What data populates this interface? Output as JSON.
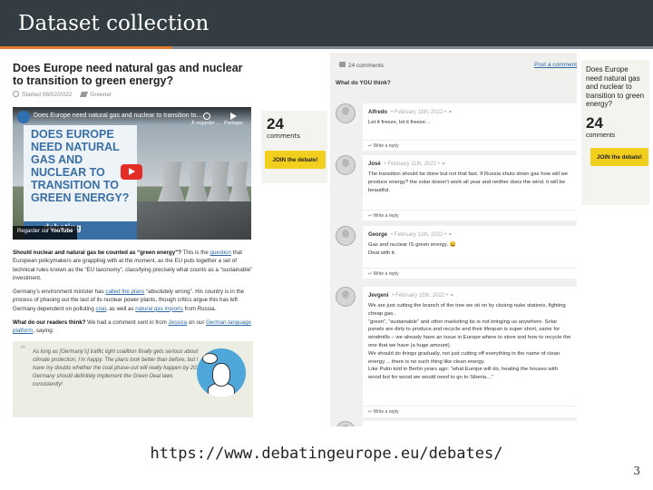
{
  "slide": {
    "title": "Dataset collection",
    "url": "https://www.debatingeurope.eu/debates/",
    "page_number": "3"
  },
  "article": {
    "title": "Does Europe need natural gas and nuclear to transition to green energy?",
    "started": "Started 08/02/2022",
    "tag": "Greener",
    "video": {
      "title": "Does Europe need natural gas and nuclear to transition to…",
      "later": "À regarder …",
      "share": "Partager",
      "panel_text": "DOES EUROPE NEED NATURAL GAS AND NUCLEAR TO TRANSITION TO GREEN ENERGY?",
      "brand": "debating",
      "watch_on": "Regarder sur",
      "watch_site": "YouTube"
    },
    "para1_bold": "Should nuclear and natural gas be counted as “green energy”?",
    "para1_a": " This is the ",
    "para1_link": "question",
    "para1_b": " that European policymakers are grappling with at the moment, as the EU puts together a set of technical rules known as the “EU taxonomy”, classifying precisely what counts as a “sustainable” investment.",
    "para2_a": "Germany’s environment minister has ",
    "para2_link1": "called the plans",
    "para2_b": " “absolutely wrong”. His country is in the process of phasing out the last of its nuclear power plants, though critics argue this has left Germany dependent on polluting ",
    "para2_link2": "coal",
    "para2_c": ", as well as ",
    "para2_link3": "natural gas imports",
    "para2_d": " from Russia.",
    "para3_bold": "What do our readers think?",
    "para3_a": " We had a comment sent in from ",
    "para3_link1": "Jessica",
    "para3_b": " on our ",
    "para3_link2": "German-language platform",
    "para3_c": ", saying:",
    "quote": "As long as [Germany’s] traffic light coalition finally gets serious about climate protection, I’m happy. The plans look better than before, but I have my doubts whether the coal phase-out will really happen by 2030. Germany should definitely implement the Green Deal laws consistently!"
  },
  "count_box": {
    "count": "24",
    "label": "comments",
    "join": "JOIN the debate!"
  },
  "comments": {
    "header": "24 comments",
    "post": "Post a comment",
    "question": "What do YOU think?",
    "reply_label": "Write a reply",
    "items": [
      {
        "author": "Alfredo",
        "date": "February 11th, 2022",
        "text": "Let it freeze, let it freeze…"
      },
      {
        "author": "José",
        "date": "February 11th, 2022",
        "text": "The transition should be done but not that fast. If Russia shuts down gas how will we produce energy? the solar doesn’t work all year and neither does the wind. it will be beautiful."
      },
      {
        "author": "George",
        "date": "February 11th, 2022",
        "text": "Gas and nuclear IS green energy. 😀\nDeal with it."
      },
      {
        "author": "Jevgeni",
        "date": "February 15th, 2022",
        "text": "We are just cutting the branch of the tree we sit on by closing nuke stations, fighting cheap gas..\n“green”, “sustainable” and other marketing bs is not bringing us anywhere. Solar panels are dirty to produce and recycle and their lifespan is super short, same for windmills – we already have an issue in Europe where to store and how to recycle the one that we have (a huge amount).\nWe should do things gradually, not just cutting off everything in the name of clean energy. .. there is no such thing like clean energy.\nLike Putin told in Berlin years ago: “what Europe will do, heating the houses with wood but for wood we would need to go to Siberia…”"
      }
    ]
  },
  "sidebar": {
    "title": "Does Europe need natural gas and nuclear to transition to green energy?",
    "count": "24",
    "label": "comments",
    "join": "JOIN the debate!"
  }
}
